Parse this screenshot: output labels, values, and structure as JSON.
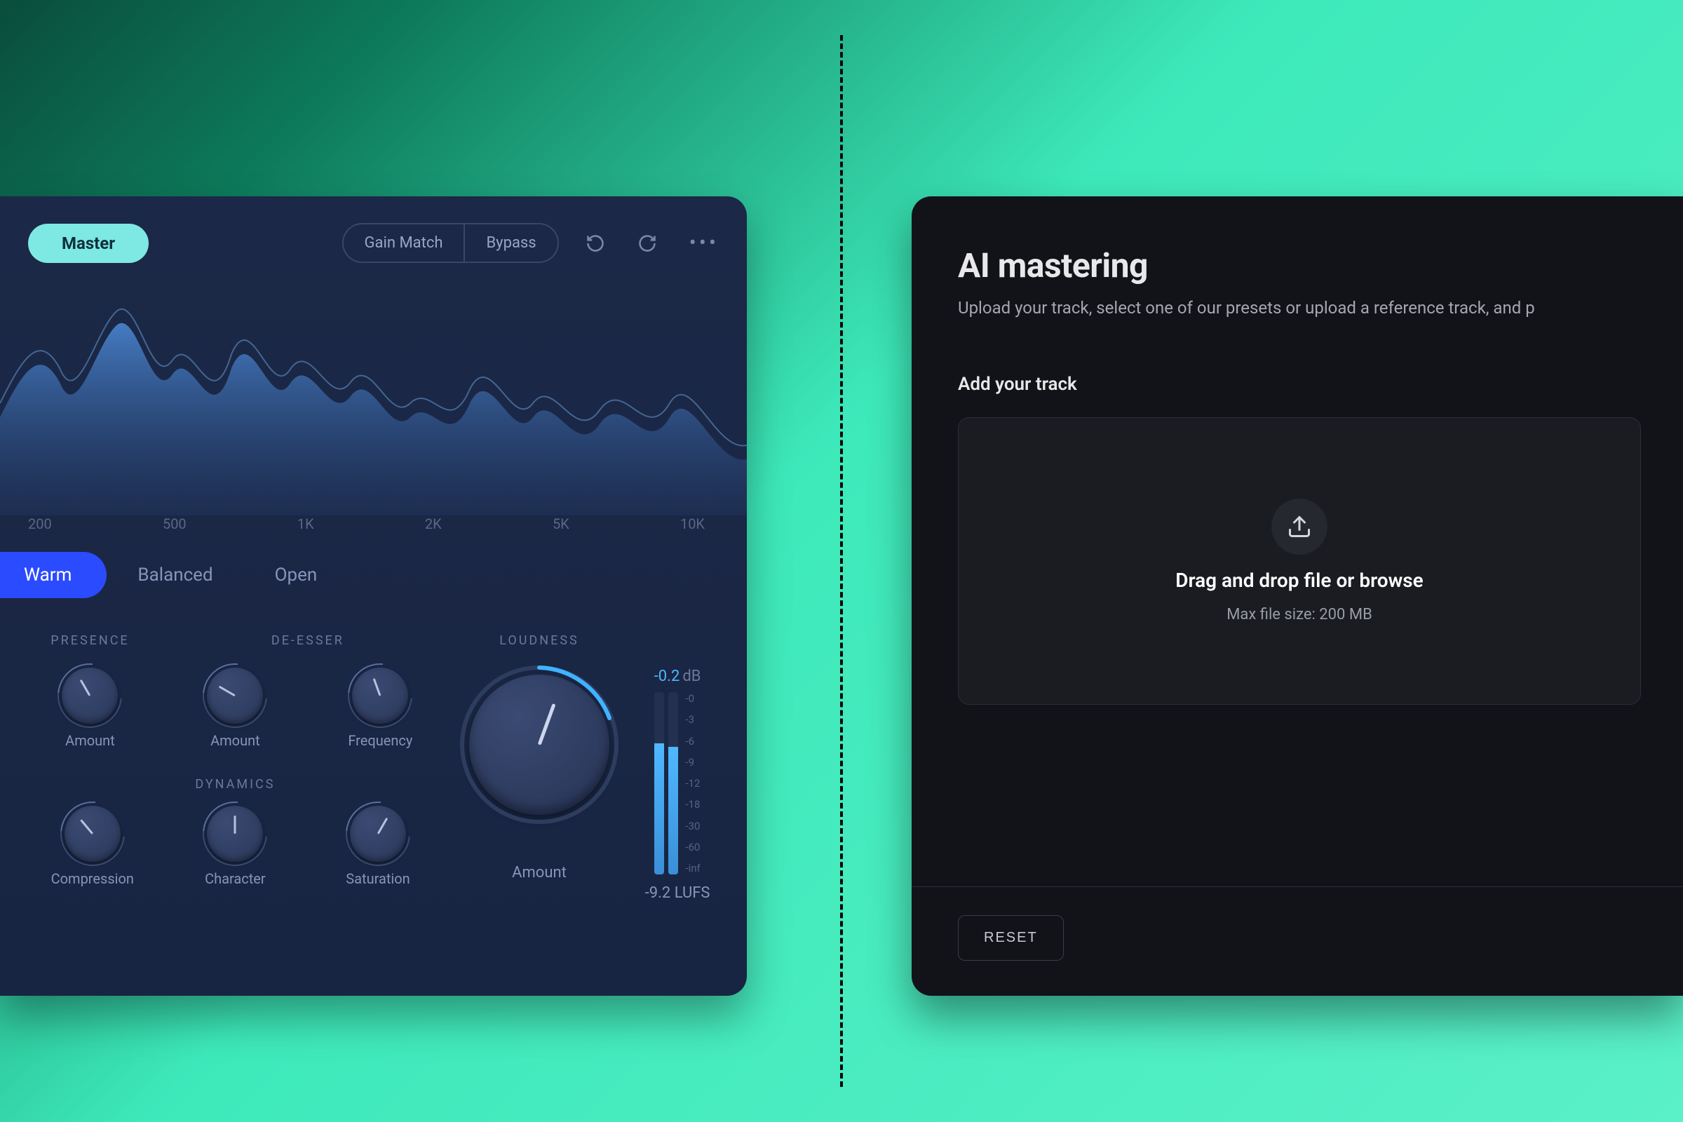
{
  "left": {
    "header": {
      "master_label": "Master",
      "gain_match_label": "Gain Match",
      "bypass_label": "Bypass"
    },
    "freq_ticks": [
      "200",
      "500",
      "1K",
      "2K",
      "5K",
      "10K"
    ],
    "tabs": {
      "warm": "Warm",
      "balanced": "Balanced",
      "open": "Open"
    },
    "sections": {
      "presence": "PRESENCE",
      "deesser": "DE-ESSER",
      "loudness": "LOUDNESS",
      "dynamics": "DYNAMICS"
    },
    "knobs": {
      "presence_amount": "Amount",
      "deesser_amount": "Amount",
      "deesser_frequency": "Frequency",
      "compression": "Compression",
      "character": "Character",
      "saturation": "Saturation",
      "loudness_amount": "Amount"
    },
    "meter": {
      "db_value": "-0.2",
      "db_unit": "dB",
      "ticks": [
        "-0",
        "-3",
        "-6",
        "-9",
        "-12",
        "-18",
        "-30",
        "-60",
        "-inf"
      ],
      "lufs_value": "-9.2",
      "lufs_unit": "LUFS"
    }
  },
  "right": {
    "title": "AI mastering",
    "subtitle": "Upload your track, select one of our presets or upload a reference track, and p",
    "section_title": "Add your track",
    "dropzone": {
      "title": "Drag and drop file or browse",
      "sub": "Max file size: 200 MB"
    },
    "reset_label": "RESET"
  }
}
